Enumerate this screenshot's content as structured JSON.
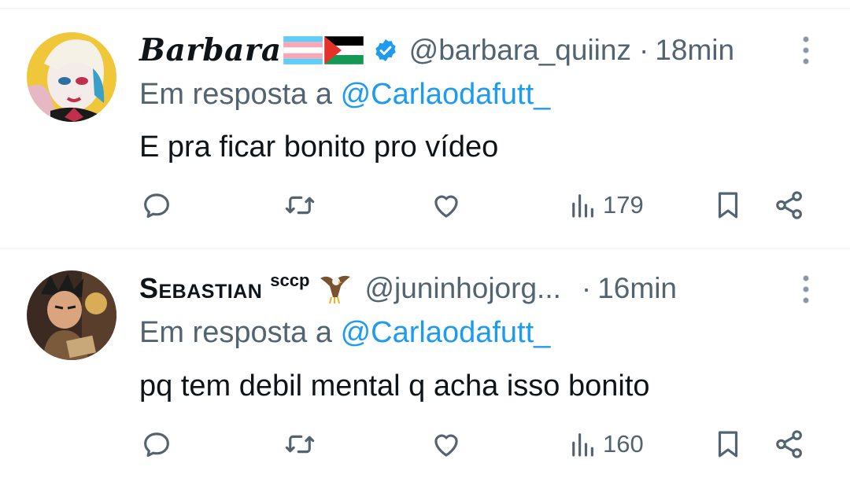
{
  "tweets": [
    {
      "display_name": "Barbara",
      "handle": "@barbara_quiinz",
      "dot": "·",
      "time": "18min",
      "reply_prefix": "Em resposta a ",
      "reply_to": "@Carlaodafutt_",
      "text": "E pra ficar bonito pro vídeo",
      "views": "179",
      "verified": true,
      "flags": [
        "transgender-flag",
        "palestine-flag"
      ]
    },
    {
      "display_name": "Sebastian",
      "badge": "sccp",
      "handle": "@juninhojorg...",
      "dot": "·",
      "time": "16min",
      "reply_prefix": "Em resposta a ",
      "reply_to": "@Carlaodafutt_",
      "text": "pq tem debil mental q acha isso bonito",
      "views": "160",
      "verified": false,
      "emoji": "eagle"
    }
  ],
  "icons": [
    "reply-icon",
    "retweet-icon",
    "like-icon",
    "views-icon",
    "bookmark-icon",
    "share-icon",
    "more-icon"
  ],
  "colors": {
    "text": "#0f1419",
    "secondary": "#536471",
    "mention": "#1d9bf0",
    "divider": "#eff3f4"
  }
}
